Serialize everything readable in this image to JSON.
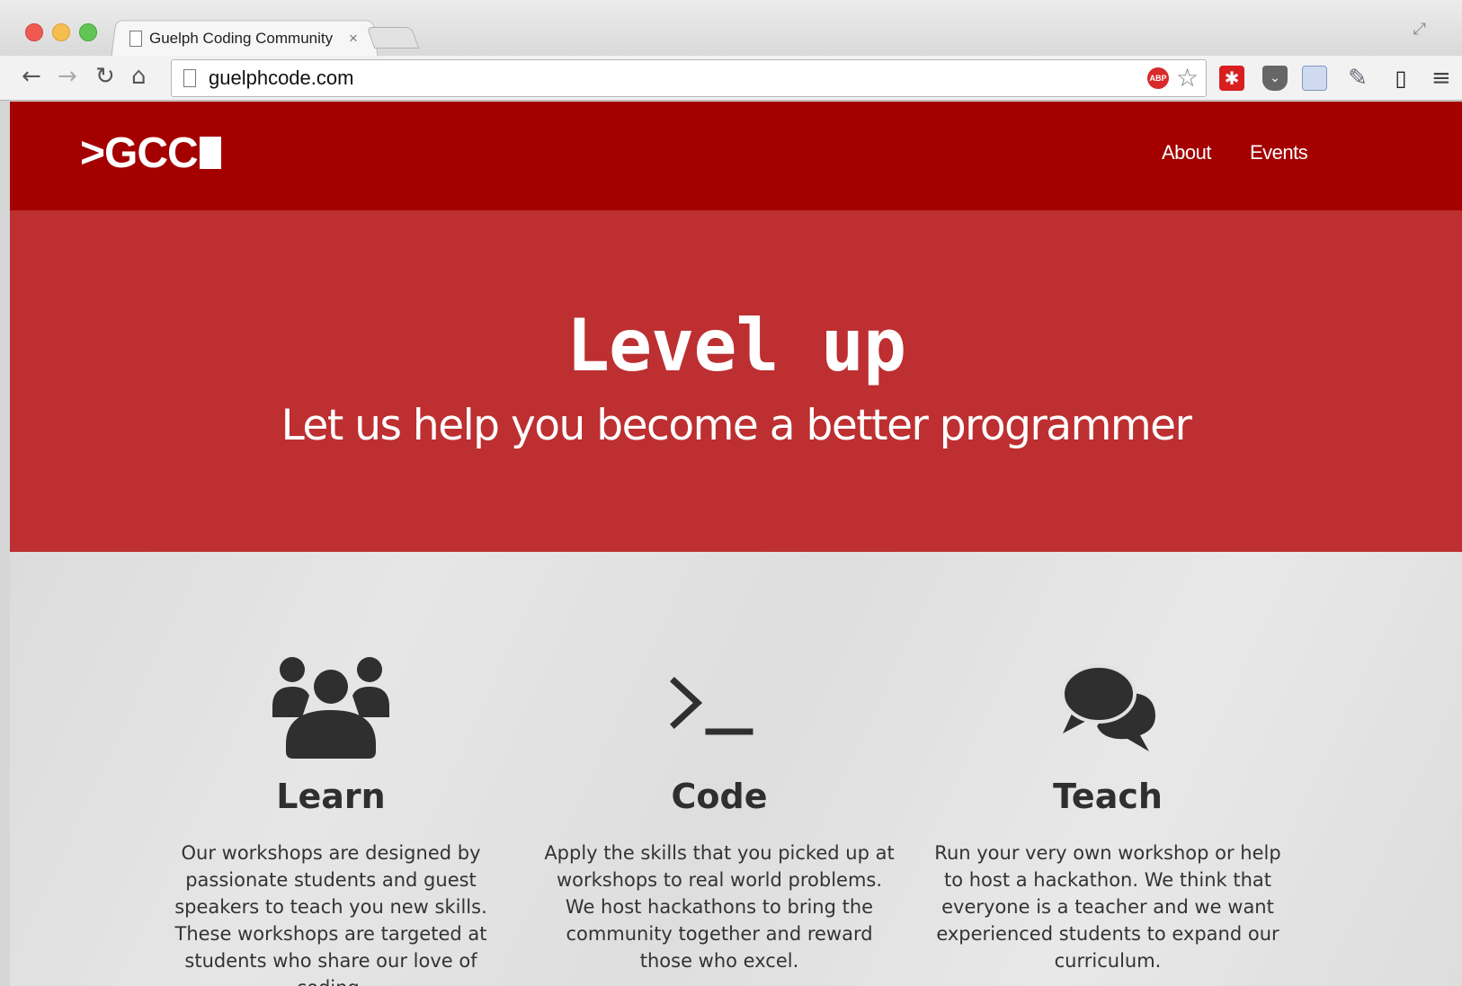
{
  "browser": {
    "tab_title": "Guelph Coding Community",
    "tab_close": "×",
    "url": "guelphcode.com",
    "extensions": {
      "adblock_label": "ABP"
    }
  },
  "site": {
    "logo_text": ">GCC",
    "nav": [
      {
        "label": "About"
      },
      {
        "label": "Events"
      }
    ],
    "hero": {
      "title": "Level up",
      "subtitle": "Let us help you become a better programmer"
    },
    "features": [
      {
        "icon": "group-icon",
        "title": "Learn",
        "text": "Our workshops are designed by passionate students and guest speakers to teach you new skills. These workshops are targeted at students who share our love of coding."
      },
      {
        "icon": "terminal-prompt-icon",
        "title": "Code",
        "text": "Apply the skills that you picked up at workshops to real world problems. We host hackathons to bring the community together and reward those who excel."
      },
      {
        "icon": "chat-bubbles-icon",
        "title": "Teach",
        "text": "Run your very own workshop or help to host a hackathon. We think that everyone is a teacher and we want experienced students to expand our curriculum."
      }
    ]
  },
  "colors": {
    "nav_bg": "#a40000",
    "hero_bg": "#bd2f31",
    "feature_bg": "#e3e3e3",
    "feature_text": "#333333"
  }
}
